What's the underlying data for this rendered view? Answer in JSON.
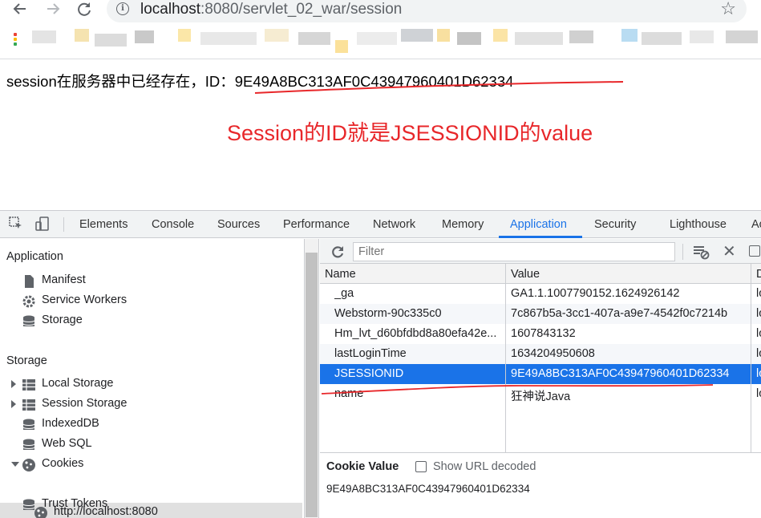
{
  "browser": {
    "url_host": "localhost",
    "url_rest": ":8080/servlet_02_war/session"
  },
  "page": {
    "message_prefix": "session在服务器中已经存在，ID：",
    "session_id": "9E49A8BC313AF0C43947960401D62334",
    "annotation": "Session的ID就是JSESSIONID的value",
    "annotation_color": "#e8272a"
  },
  "devtools": {
    "tabs": [
      "Elements",
      "Console",
      "Sources",
      "Performance",
      "Network",
      "Memory",
      "Application",
      "Security",
      "Lighthouse",
      "Ac"
    ],
    "active_tab": "Application",
    "accent": "#1a73e8",
    "sidebar": {
      "application_header": "Application",
      "application_items": [
        {
          "label": "Manifest",
          "icon": "document-icon"
        },
        {
          "label": "Service Workers",
          "icon": "gear-icon"
        },
        {
          "label": "Storage",
          "icon": "database-icon"
        }
      ],
      "storage_header": "Storage",
      "storage_items": [
        {
          "label": "Local Storage",
          "icon": "grid-icon",
          "expandable": true
        },
        {
          "label": "Session Storage",
          "icon": "grid-icon",
          "expandable": true
        },
        {
          "label": "IndexedDB",
          "icon": "database-icon"
        },
        {
          "label": "Web SQL",
          "icon": "database-icon"
        },
        {
          "label": "Cookies",
          "icon": "cookie-icon",
          "expanded": true
        },
        {
          "label": "http://localhost:8080",
          "icon": "cookie-icon",
          "selected": true
        },
        {
          "label": "Trust Tokens",
          "icon": "database-icon"
        }
      ]
    },
    "filter_placeholder": "Filter",
    "table": {
      "columns": [
        "Name",
        "Value",
        "D"
      ],
      "rows": [
        {
          "name": "_ga",
          "value": "GA1.1.1007790152.1624926142",
          "domain": "lo"
        },
        {
          "name": "Webstorm-90c335c0",
          "value": "7c867b5a-3cc1-407a-a9e7-4542f0c7214b",
          "domain": "lo"
        },
        {
          "name": "Hm_lvt_d60bfdbd8a80efa42e...",
          "value": "1607843132",
          "domain": "lo"
        },
        {
          "name": "lastLoginTime",
          "value": "1634204950608",
          "domain": "lo"
        },
        {
          "name": "JSESSIONID",
          "value": "9E49A8BC313AF0C43947960401D62334",
          "domain": "lo",
          "selected": true
        },
        {
          "name": "name",
          "value": "狂神说Java",
          "domain": "lo"
        }
      ]
    },
    "cookie_value_title": "Cookie Value",
    "show_url_decoded_label": "Show URL decoded",
    "cookie_value": "9E49A8BC313AF0C43947960401D62334"
  }
}
